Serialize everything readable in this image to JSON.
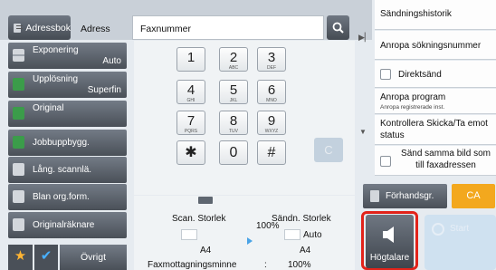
{
  "header": {
    "address_book_label": "Adressbok",
    "address_label": "Adress",
    "fax_input_value": "Faxnummer"
  },
  "left_menu": [
    {
      "label": "Exponering",
      "value": "Auto"
    },
    {
      "label": "Upplösning",
      "value": "Superfin"
    },
    {
      "label": "Original",
      "value": ""
    },
    {
      "label": "Jobbuppbygg.",
      "value": ""
    },
    {
      "label": "Lång. scannlä.",
      "value": ""
    },
    {
      "label": "Blan org.form.",
      "value": ""
    },
    {
      "label": "Originalräknare",
      "value": ""
    }
  ],
  "bottom_left": {
    "other_label": "Övrigt"
  },
  "keypad": {
    "keys": [
      {
        "n": "1",
        "s": ""
      },
      {
        "n": "2",
        "s": "ABC"
      },
      {
        "n": "3",
        "s": "DEF"
      },
      {
        "n": "4",
        "s": "GHI"
      },
      {
        "n": "5",
        "s": "JKL"
      },
      {
        "n": "6",
        "s": "MNO"
      },
      {
        "n": "7",
        "s": "PQRS"
      },
      {
        "n": "8",
        "s": "TUV"
      },
      {
        "n": "9",
        "s": "WXYZ"
      },
      {
        "n": "✱",
        "s": ""
      },
      {
        "n": "0",
        "s": ""
      },
      {
        "n": "#",
        "s": ""
      }
    ],
    "clear_label": "C"
  },
  "scan_info": {
    "scan_size_label": "Scan. Storlek",
    "send_size_label": "Sändn. Storlek",
    "ratio": "100%",
    "send_size_value": "Auto",
    "scan_paper": "A4",
    "send_paper": "A4",
    "fax_memory_label": "Faxmottagningsminne",
    "fax_memory_sep": ":",
    "fax_memory_value": "100%"
  },
  "right_panel": {
    "items": [
      {
        "label": "Sändningshistorik"
      },
      {
        "label": "Anropa sökningsnummer"
      },
      {
        "label": "Direktsänd",
        "checkbox": true
      },
      {
        "label": "Anropa program",
        "sub": "Anropa registrerade inst."
      },
      {
        "label": "Kontrollera Skicka/Ta emot status"
      },
      {
        "label": "Sänd samma bild som till faxadressen",
        "checkbox": true
      }
    ]
  },
  "actions": {
    "preview_label": "Förhandsgr.",
    "ca_label": "CA",
    "speaker_label": "Högtalare",
    "start_label": "Start"
  },
  "colors": {
    "accent_orange": "#f3a81e",
    "highlight_red": "#e2231a",
    "start_blue": "#cfe1f0"
  }
}
